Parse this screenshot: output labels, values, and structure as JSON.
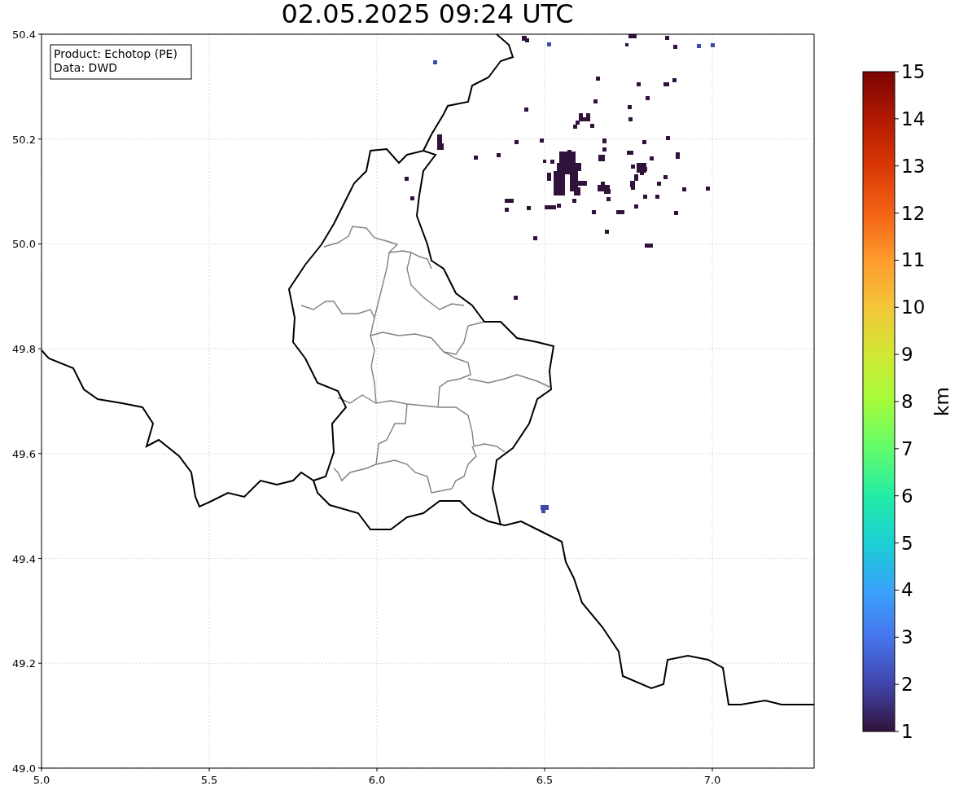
{
  "title": "02.05.2025 09:24 UTC",
  "legend": [
    "Product: Echotop (PE)",
    "Data: DWD"
  ],
  "x_axis": {
    "ticks": [
      "5.0",
      "5.5",
      "6.0",
      "6.5",
      "7.0"
    ]
  },
  "y_axis": {
    "ticks": [
      "50.4",
      "50.2",
      "50.0",
      "49.8",
      "49.6",
      "49.4",
      "49.2",
      "49.0"
    ]
  },
  "colorbar": {
    "label": "km",
    "ticks": [
      "15",
      "14",
      "13",
      "12",
      "11",
      "10",
      "9",
      "8",
      "7",
      "6",
      "5",
      "4",
      "3",
      "2",
      "1"
    ]
  }
}
